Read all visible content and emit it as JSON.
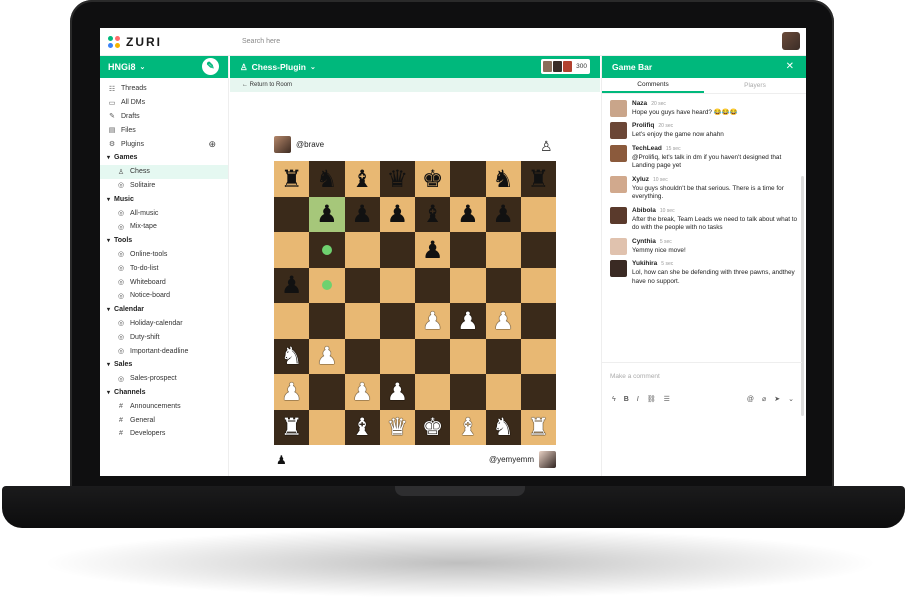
{
  "app": {
    "logo_text": "ZURI",
    "search_placeholder": "Search here"
  },
  "sidebar": {
    "org_name": "HNGi8",
    "top_items": [
      {
        "label": "Threads",
        "icon": "threads-icon"
      },
      {
        "label": "All DMs",
        "icon": "dms-icon"
      },
      {
        "label": "Drafts",
        "icon": "drafts-icon"
      },
      {
        "label": "Files",
        "icon": "files-icon"
      },
      {
        "label": "Plugins",
        "icon": "plugins-icon"
      }
    ],
    "sections": [
      {
        "title": "Games",
        "items": [
          "Chess",
          "Solitaire"
        ]
      },
      {
        "title": "Music",
        "items": [
          "All-music",
          "Mix-tape"
        ]
      },
      {
        "title": "Tools",
        "items": [
          "Online-tools",
          "To-do-list",
          "Whiteboard",
          "Notice-board"
        ]
      },
      {
        "title": "Calendar",
        "items": [
          "Holiday-calendar",
          "Duty-shift",
          "Important-deadline"
        ]
      },
      {
        "title": "Sales",
        "items": [
          "Sales-prospect"
        ]
      },
      {
        "title": "Channels",
        "items": [
          "Announcements",
          "General",
          "Developers"
        ]
      }
    ]
  },
  "center": {
    "plugin_title": "Chess-Plugin",
    "member_count": "300",
    "return_label": "Return to Room",
    "player_top": "@brave",
    "player_bottom": "@yemyemm"
  },
  "board": {
    "rows": [
      [
        "br",
        "bn",
        "bb",
        "bq",
        "bk",
        "",
        "bn",
        "br"
      ],
      [
        "",
        "bp*",
        "bp",
        "bp",
        "bb",
        "bp",
        "bp",
        ""
      ],
      [
        "",
        "dot",
        "",
        "",
        "bp",
        "",
        "",
        ""
      ],
      [
        "bp",
        "dot",
        "",
        "",
        "",
        "",
        "",
        ""
      ],
      [
        "",
        "",
        "",
        "",
        "wp",
        "wp",
        "wp",
        ""
      ],
      [
        "wn",
        "wp",
        "",
        "",
        "",
        "",
        "",
        ""
      ],
      [
        "wp",
        "",
        "wp",
        "wp",
        "",
        "",
        "",
        ""
      ],
      [
        "wr",
        "",
        "wb",
        "wq",
        "wk",
        "wb",
        "wn",
        "wr"
      ]
    ]
  },
  "game_bar": {
    "title": "Game Bar",
    "tabs": [
      "Comments",
      "Players"
    ],
    "comments": [
      {
        "name": "Naza",
        "time": "20 sec",
        "text": "Hope you guys have heard? 😂😂😂"
      },
      {
        "name": "Prolifiq",
        "time": "20 sec",
        "text": "Let's enjoy the game now ahahn"
      },
      {
        "name": "TechLead",
        "time": "15 sec",
        "text": "@Prolifiq, let's talk in dm if you haven't designed that Landing page yet"
      },
      {
        "name": "Xyluz",
        "time": "10 sec",
        "text": "You guys shouldn't be that serious. There is a time for everything."
      },
      {
        "name": "Abibola",
        "time": "10 sec",
        "text": "After the break, Team Leads we need to talk about what to do with the people with no tasks"
      },
      {
        "name": "Cynthia",
        "time": "5 sec",
        "text": "Yemmy nice move!"
      },
      {
        "name": "Yukihira",
        "time": "5 sec",
        "text": "Lol, how can she be defending with three pawns, andthey have no support."
      }
    ],
    "composer_placeholder": "Make a comment"
  }
}
